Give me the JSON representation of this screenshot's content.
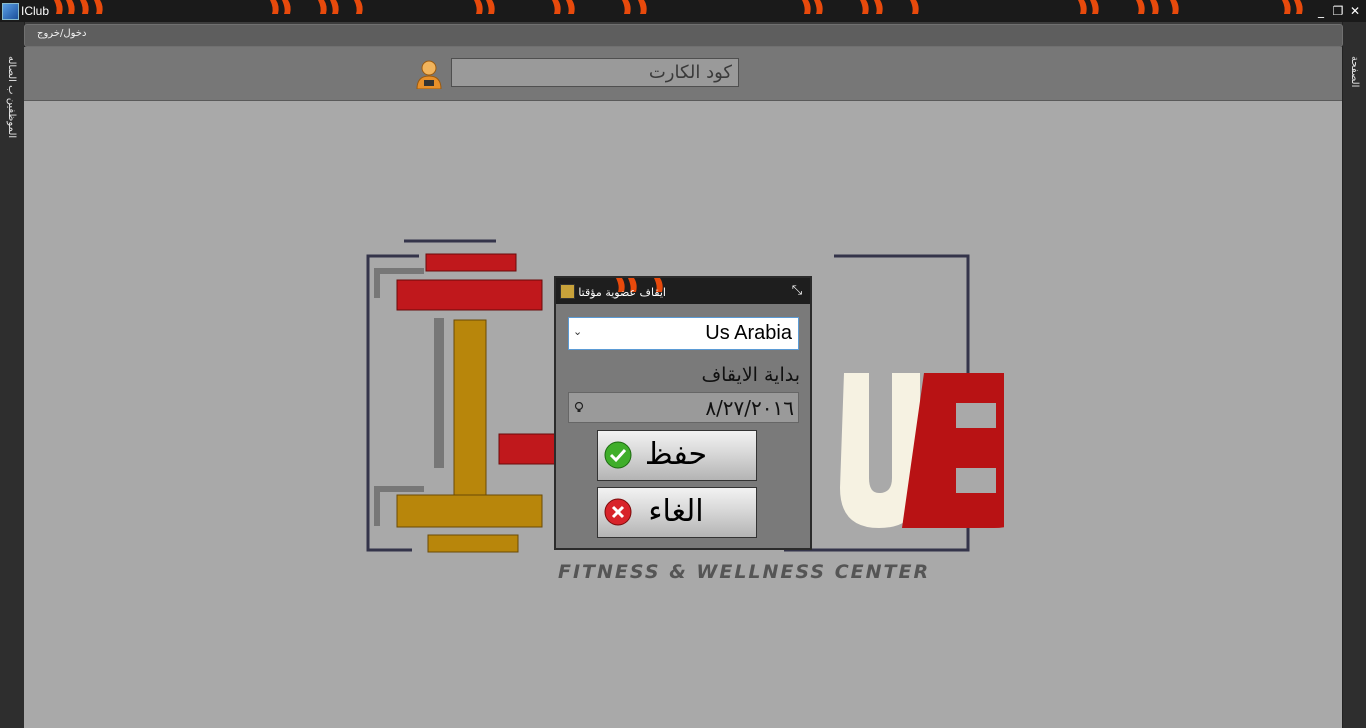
{
  "window": {
    "title": "IClub"
  },
  "left_strip": {
    "label": "الموظفين ب الصاله"
  },
  "right_strip": {
    "label": "الصفحة"
  },
  "menubar": {
    "item": "دخول/خروج"
  },
  "card_code": {
    "placeholder": "كود الكارت"
  },
  "logo": {
    "tagline": "FITNESS & WELLNESS CENTER",
    "brand_letters": "UB"
  },
  "dialog": {
    "title": "ايقاف عضوية مؤقتا",
    "branch_select": {
      "value": "Us Arabia"
    },
    "start_label": "بداية الايقاف",
    "start_date": "٨/٢٧/٢٠١٦",
    "save_label": "حفظ",
    "cancel_label": "الغاء"
  },
  "colors": {
    "logo_red": "#c0181c",
    "logo_gold": "#b8860b",
    "save_icon": "#3fae2a",
    "cancel_icon": "#d8232a"
  },
  "icons": [
    "app-icon",
    "flame-decoration",
    "minimize-icon",
    "restore-icon",
    "close-icon",
    "user-icon",
    "dialog-icon",
    "maximize-icon",
    "chevron-down-icon",
    "calendar-icon",
    "check-icon",
    "cancel-x-icon"
  ]
}
